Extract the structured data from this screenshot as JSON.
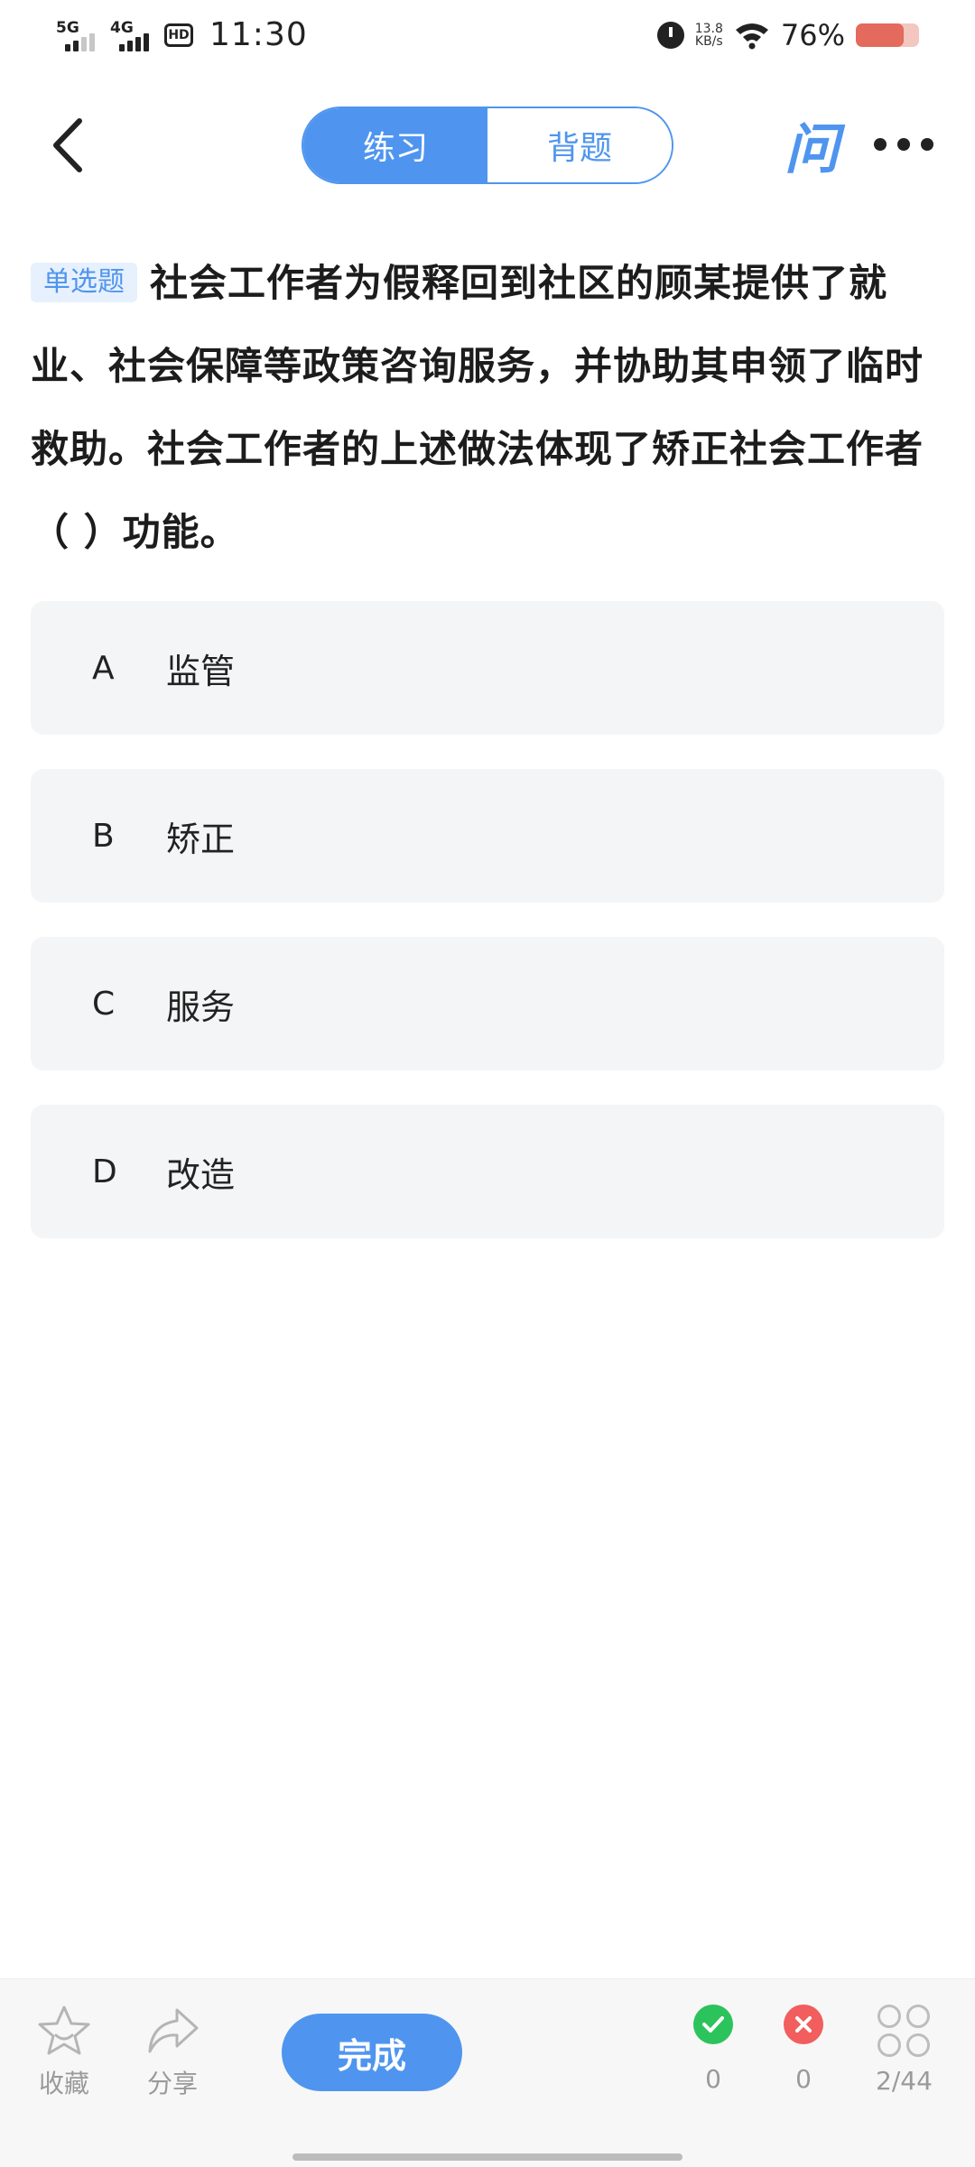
{
  "status_bar": {
    "signal1": "5G",
    "signal2": "4G",
    "hd": "HD",
    "time": "11:30",
    "net_speed_value": "13.8",
    "net_speed_unit": "KB/s",
    "battery_percent_text": "76%",
    "battery_level": 0.76
  },
  "header": {
    "tabs": [
      {
        "label": "练习",
        "active": true
      },
      {
        "label": "背题",
        "active": false
      }
    ],
    "ask_label": "问"
  },
  "question": {
    "type_badge": "单选题",
    "text": "社会工作者为假释回到社区的顾某提供了就业、社会保障等政策咨询服务，并协助其申领了临时救助。社会工作者的上述做法体现了矫正社会工作者（ ）功能。"
  },
  "options": [
    {
      "letter": "A",
      "text": "监管"
    },
    {
      "letter": "B",
      "text": "矫正"
    },
    {
      "letter": "C",
      "text": "服务"
    },
    {
      "letter": "D",
      "text": "改造"
    }
  ],
  "bottom_bar": {
    "favorite_label": "收藏",
    "share_label": "分享",
    "done_label": "完成",
    "correct_count": "0",
    "wrong_count": "0",
    "progress": "2/44"
  },
  "colors": {
    "accent": "#4f95ef",
    "correct": "#2cc35c",
    "wrong": "#f25d5d",
    "option_bg": "#f4f5f7"
  }
}
